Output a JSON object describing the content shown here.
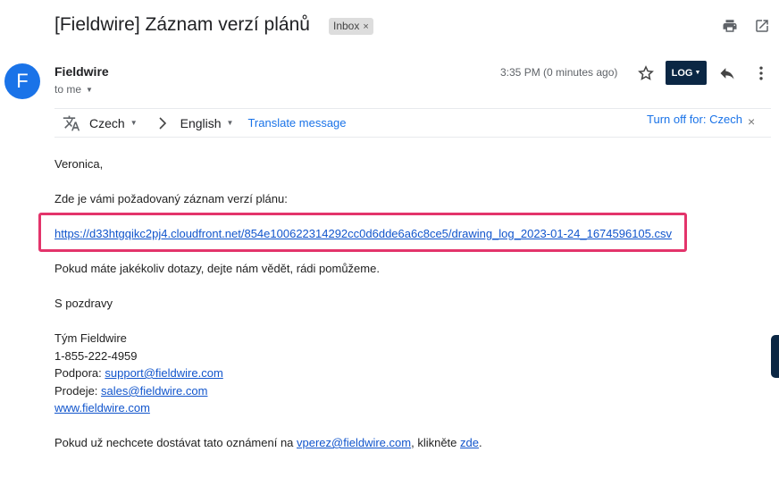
{
  "header": {
    "subject": "[Fieldwire] Záznam verzí plánů",
    "label": "Inbox",
    "label_remove": "×",
    "print_icon": "print-icon",
    "open_new_window_icon": "open-in-new-window-icon"
  },
  "message": {
    "avatar_letter": "F",
    "avatar_color": "#1a73e8",
    "sender": "Fieldwire",
    "recipient": "to me",
    "time": "3:35 PM (0 minutes ago)",
    "log_button": "LOG",
    "icons": [
      "star-icon",
      "reply-icon",
      "more-vert-icon"
    ]
  },
  "translate_bar": {
    "source_language": "Czech",
    "target_language": "English",
    "translate_link": "Translate message",
    "turn_off": "Turn off for: Czech",
    "close": "×"
  },
  "body": {
    "greeting": "Veronica,",
    "intro": "Zde je vámi požadovaný záznam verzí plánu:",
    "link": "https://d33htgqikc2pj4.cloudfront.net/854e100622314292cc0d6dde6a6c8ce5/drawing_log_2023-01-24_1674596105.csv",
    "questions": "Pokud máte jakékoliv dotazy, dejte nám vědět, rádi pomůžeme.",
    "regards": "S pozdravy",
    "team": "Tým Fieldwire",
    "phone": "1-855-222-4959",
    "support_label": "Podpora: ",
    "support_email": "support@fieldwire.com",
    "sales_label": "Prodeje: ",
    "sales_email": "sales@fieldwire.com",
    "website": "www.fieldwire.com",
    "unsubscribe_prefix": "Pokud už nechcete dostávat tato oznámení na ",
    "unsubscribe_email": "vperez@fieldwire.com",
    "unsubscribe_middle": ", klikněte ",
    "unsubscribe_link": "zde",
    "unsubscribe_suffix": "."
  },
  "colors": {
    "highlight_border": "#e3346b",
    "log_button_bg": "#0b2744",
    "link": "#1155cc"
  }
}
